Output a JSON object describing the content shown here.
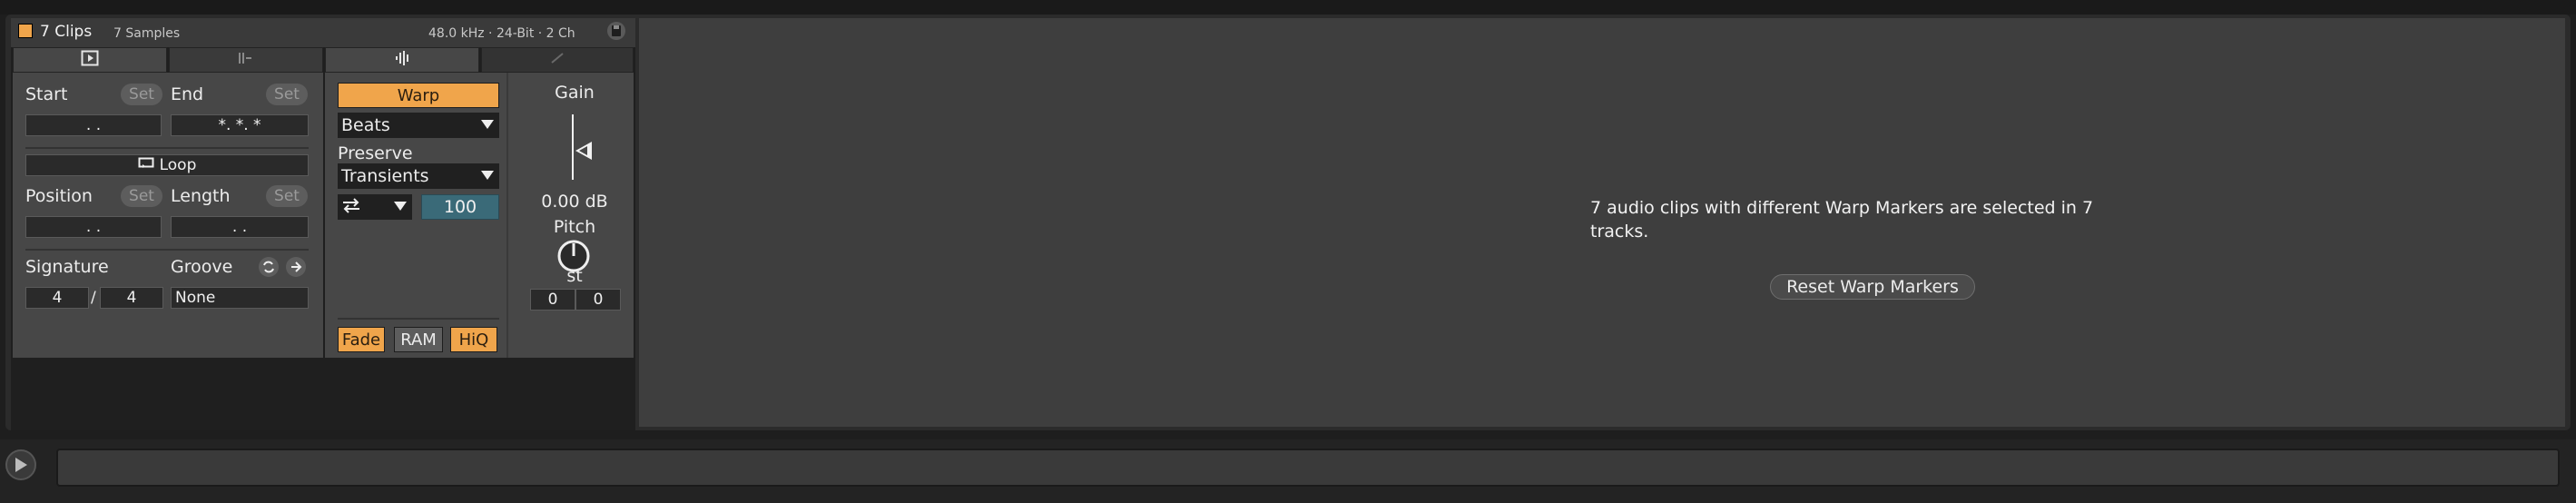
{
  "clip": {
    "title": "7 Clips",
    "samples": "7 Samples",
    "format": "48.0 kHz · 24-Bit · 2 Ch",
    "start_label": "Start",
    "end_label": "End",
    "set_label": "Set",
    "start_value": ".    .",
    "end_value": "*.    *.    *",
    "loop_label": "Loop",
    "position_label": "Position",
    "length_label": "Length",
    "position_value": ".    .",
    "length_value": ".    .",
    "signature_label": "Signature",
    "groove_label": "Groove",
    "sig_num": "4",
    "sig_den": "4",
    "sig_slash": "/",
    "groove_value": "None"
  },
  "sample": {
    "warp_label": "Warp",
    "warp_mode": "Beats",
    "preserve_label": "Preserve",
    "preserve_value": "Transients",
    "transient_amount": "100",
    "fade_label": "Fade",
    "ram_label": "RAM",
    "hiq_label": "HiQ",
    "gain_label": "Gain",
    "gain_value": "0.00 dB",
    "pitch_label": "Pitch",
    "st_label": "st",
    "pitch_coarse": "0",
    "pitch_fine": "0"
  },
  "message": {
    "text": "7 audio clips with different Warp Markers are selected in 7 tracks.",
    "reset_button": "Reset Warp Markers"
  },
  "colors": {
    "accent_orange": "#f0a54b",
    "teal": "#3a6a78"
  }
}
